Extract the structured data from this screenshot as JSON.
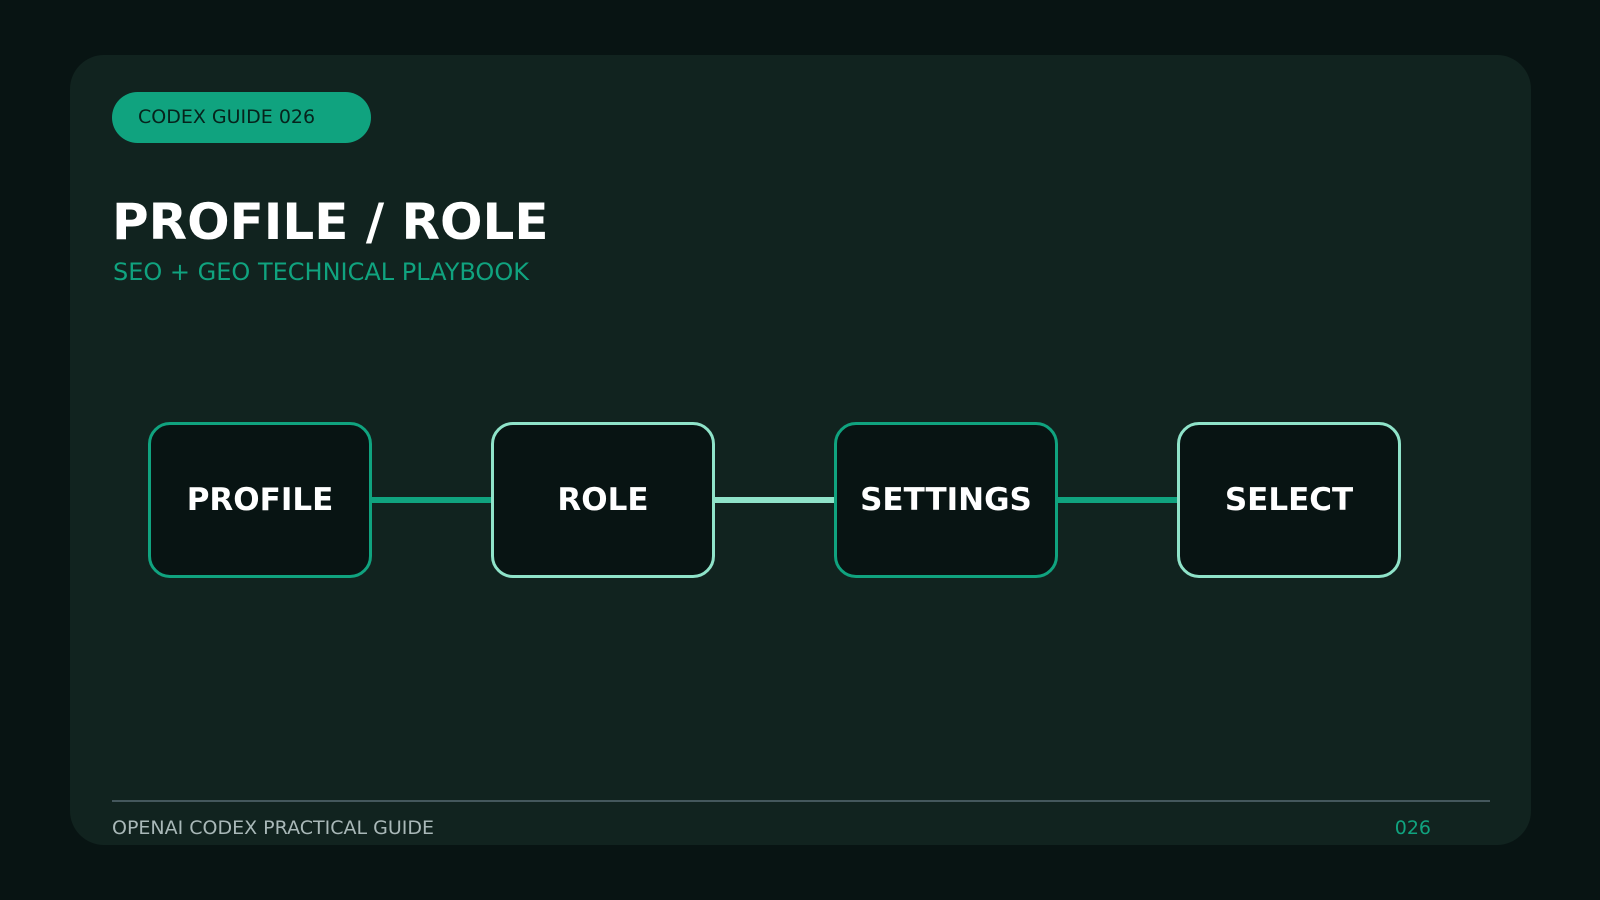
{
  "badge": {
    "label": "CODEX GUIDE 026"
  },
  "header": {
    "title": "PROFILE / ROLE",
    "subtitle": "SEO + GEO TECHNICAL PLAYBOOK"
  },
  "flow": {
    "nodes": [
      {
        "label": "PROFILE",
        "border_color": "#10a37f"
      },
      {
        "label": "ROLE",
        "border_color": "#8fe3c9"
      },
      {
        "label": "SETTINGS",
        "border_color": "#10a37f"
      },
      {
        "label": "SELECT",
        "border_color": "#8fe3c9"
      }
    ],
    "connector_colors": [
      "#10a37f",
      "#8fe3c9",
      "#10a37f"
    ]
  },
  "footer": {
    "left_text": "OPENAI CODEX PRACTICAL GUIDE",
    "page_number": "026"
  },
  "colors": {
    "background": "#081413",
    "card": "#11231f",
    "accent": "#10a37f",
    "accent_light": "#8fe3c9",
    "title": "#ffffff",
    "footer_text": "#a9b8b8"
  }
}
